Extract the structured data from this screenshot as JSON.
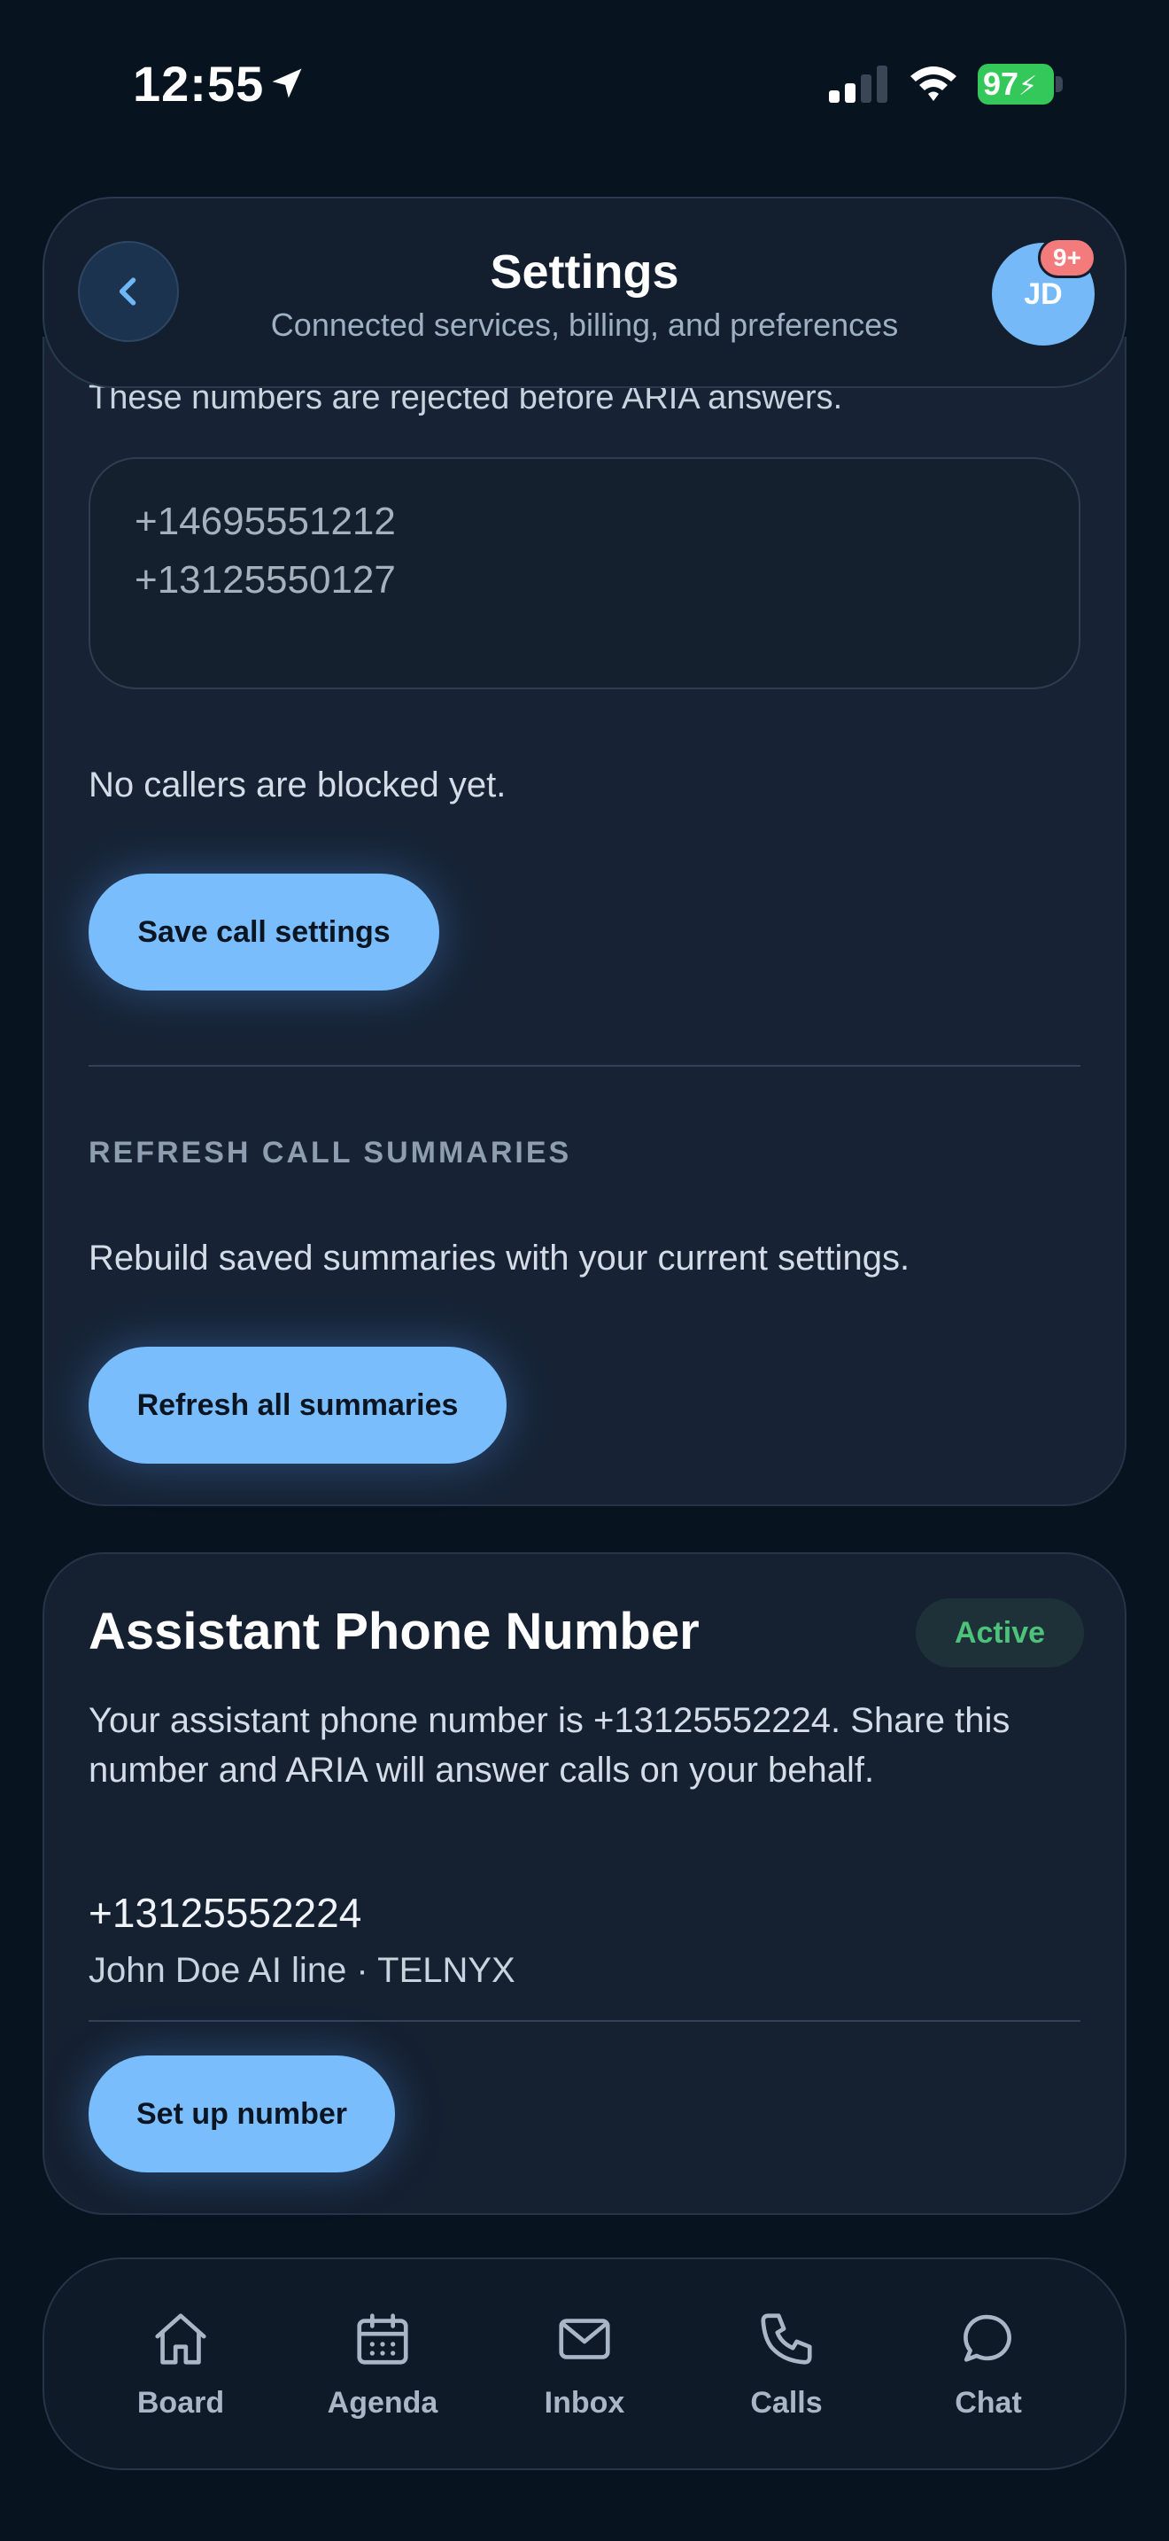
{
  "status_bar": {
    "time": "12:55",
    "battery": "97"
  },
  "header": {
    "title": "Settings",
    "subtitle": "Connected services, billing, and preferences",
    "avatar_initials": "JD",
    "notification_badge": "9+"
  },
  "call_settings": {
    "clipped_description": "These numbers are rejected before ARIA answers.",
    "blocked_numbers": [
      "+14695551212",
      "+13125550127"
    ],
    "empty_state": "No callers are blocked yet.",
    "save_label": "Save call settings"
  },
  "refresh_section": {
    "label": "REFRESH CALL SUMMARIES",
    "description": "Rebuild saved summaries with your current settings.",
    "button_label": "Refresh all summaries"
  },
  "phone_card": {
    "title": "Assistant Phone Number",
    "status": "Active",
    "description": "Your assistant phone number is +13125552224. Share this number and ARIA will answer calls on your behalf.",
    "number": "+13125552224",
    "line_info": "John Doe AI line · TELNYX",
    "setup_label": "Set up number"
  },
  "nav": {
    "items": [
      {
        "label": "Board",
        "icon": "home-icon"
      },
      {
        "label": "Agenda",
        "icon": "calendar-icon"
      },
      {
        "label": "Inbox",
        "icon": "mail-icon"
      },
      {
        "label": "Calls",
        "icon": "phone-icon"
      },
      {
        "label": "Chat",
        "icon": "chat-bubble-icon"
      }
    ]
  },
  "colors": {
    "accent": "#79bdfc",
    "background": "#081320",
    "card": "#152031",
    "active_status": "#4cc27a",
    "badge": "#f37b7b"
  }
}
